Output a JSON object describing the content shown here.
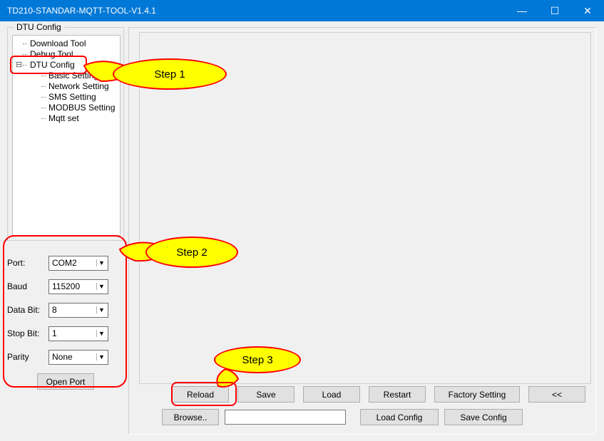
{
  "window": {
    "title": "TD210-STANDAR-MQTT-TOOL-V1.4.1"
  },
  "sidebar": {
    "group_label": "DTU Config",
    "items": [
      "Download Tool",
      "Debug Tool",
      "DTU Config",
      "Basic Setting",
      "Network Setting",
      "SMS Setting",
      "MODBUS Setting",
      "Mqtt set"
    ]
  },
  "port": {
    "port_label": "Port:",
    "port_value": "COM2",
    "baud_label": "Baud",
    "baud_value": "115200",
    "databit_label": "Data Bit:",
    "databit_value": "8",
    "stopbit_label": "Stop Bit:",
    "stopbit_value": "1",
    "parity_label": "Parity",
    "parity_value": "None",
    "open_port": "Open Port"
  },
  "buttons": {
    "reload": "Reload",
    "save": "Save",
    "load": "Load",
    "restart": "Restart",
    "factory": "Factory Setting",
    "back": "<<",
    "browse": "Browse..",
    "load_config": "Load Config",
    "save_config": "Save Config"
  },
  "annotations": {
    "step1": "Step 1",
    "step2": "Step 2",
    "step3": "Step 3"
  }
}
